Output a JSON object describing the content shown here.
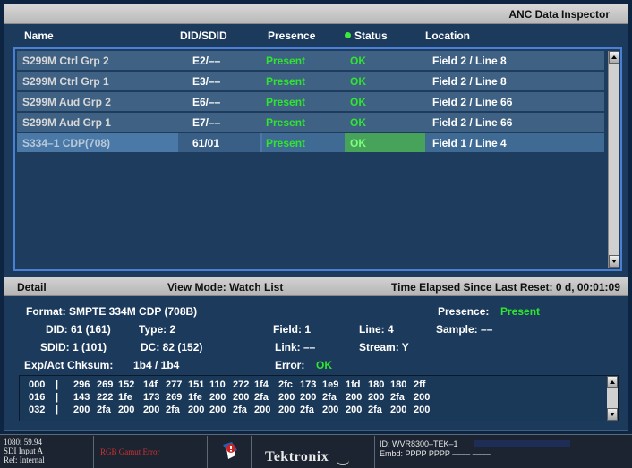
{
  "window": {
    "title": "ANC Data Inspector"
  },
  "columns": {
    "name": "Name",
    "did_sdid": "DID/SDID",
    "presence": "Presence",
    "status": "Status",
    "location": "Location"
  },
  "rows": [
    {
      "name": "S299M Ctrl Grp 2",
      "did": "E2/––",
      "presence": "Present",
      "status": "OK",
      "location": "Field 2 / Line 8"
    },
    {
      "name": "S299M Ctrl Grp 1",
      "did": "E3/––",
      "presence": "Present",
      "status": "OK",
      "location": "Field 2 / Line 8"
    },
    {
      "name": "S299M Aud Grp 2",
      "did": "E6/––",
      "presence": "Present",
      "status": "OK",
      "location": "Field 2 / Line 66"
    },
    {
      "name": "S299M Aud Grp 1",
      "did": "E7/––",
      "presence": "Present",
      "status": "OK",
      "location": "Field 2 / Line 66"
    },
    {
      "name": "S334–1 CDP(708)",
      "did": "61/01",
      "presence": "Present",
      "status": "OK",
      "location": "Field 1 / Line 4"
    }
  ],
  "detail_bar": {
    "label": "Detail",
    "view_mode": "View Mode: Watch List",
    "elapsed": "Time Elapsed Since Last Reset: 0 d, 00:01:09"
  },
  "detail": {
    "format": "Format:  SMPTE 334M CDP (708B)",
    "presence_label": "Presence:",
    "presence_value": "Present",
    "did": "DID:  61 (161)",
    "type": "Type: 2",
    "field": "Field:  1",
    "line": "Line:  4",
    "sample": "Sample:  ––",
    "sdid": "SDID:  1 (101)",
    "dc": "DC:  82 (152)",
    "link": "Link:  ––",
    "stream": "Stream:  Y",
    "checksum_label": "Exp/Act Chksum:",
    "checksum_value": "1b4 / 1b4",
    "error_label": "Error:",
    "error_value": "OK"
  },
  "hex_dump": [
    {
      "offset": "000",
      "values": [
        "296",
        "269",
        "152",
        "14f",
        "277",
        "151",
        "110",
        "272",
        "1f4",
        "2fc",
        "173",
        "1e9",
        "1fd",
        "180",
        "180",
        "2ff"
      ]
    },
    {
      "offset": "016",
      "values": [
        "143",
        "222",
        "1fe",
        "173",
        "269",
        "1fe",
        "200",
        "200",
        "2fa",
        "200",
        "200",
        "2fa",
        "200",
        "200",
        "2fa",
        "200"
      ]
    },
    {
      "offset": "032",
      "values": [
        "200",
        "2fa",
        "200",
        "200",
        "2fa",
        "200",
        "200",
        "2fa",
        "200",
        "200",
        "2fa",
        "200",
        "200",
        "2fa",
        "200",
        "200"
      ]
    }
  ],
  "statusbar": {
    "format": "1080i 59.94",
    "input": "SDI Input A",
    "ref": "Ref: Internal",
    "alarm": "RGB Gamut Error",
    "brand": "Tektronix",
    "id": "ID: WVR8300–TEK–1",
    "embd": "Embd: PPPP PPPP –––– ––––"
  },
  "colors": {
    "present_green": "#2fe52f",
    "list_border": "#4a7fd6",
    "alarm_red": "#d03030"
  }
}
